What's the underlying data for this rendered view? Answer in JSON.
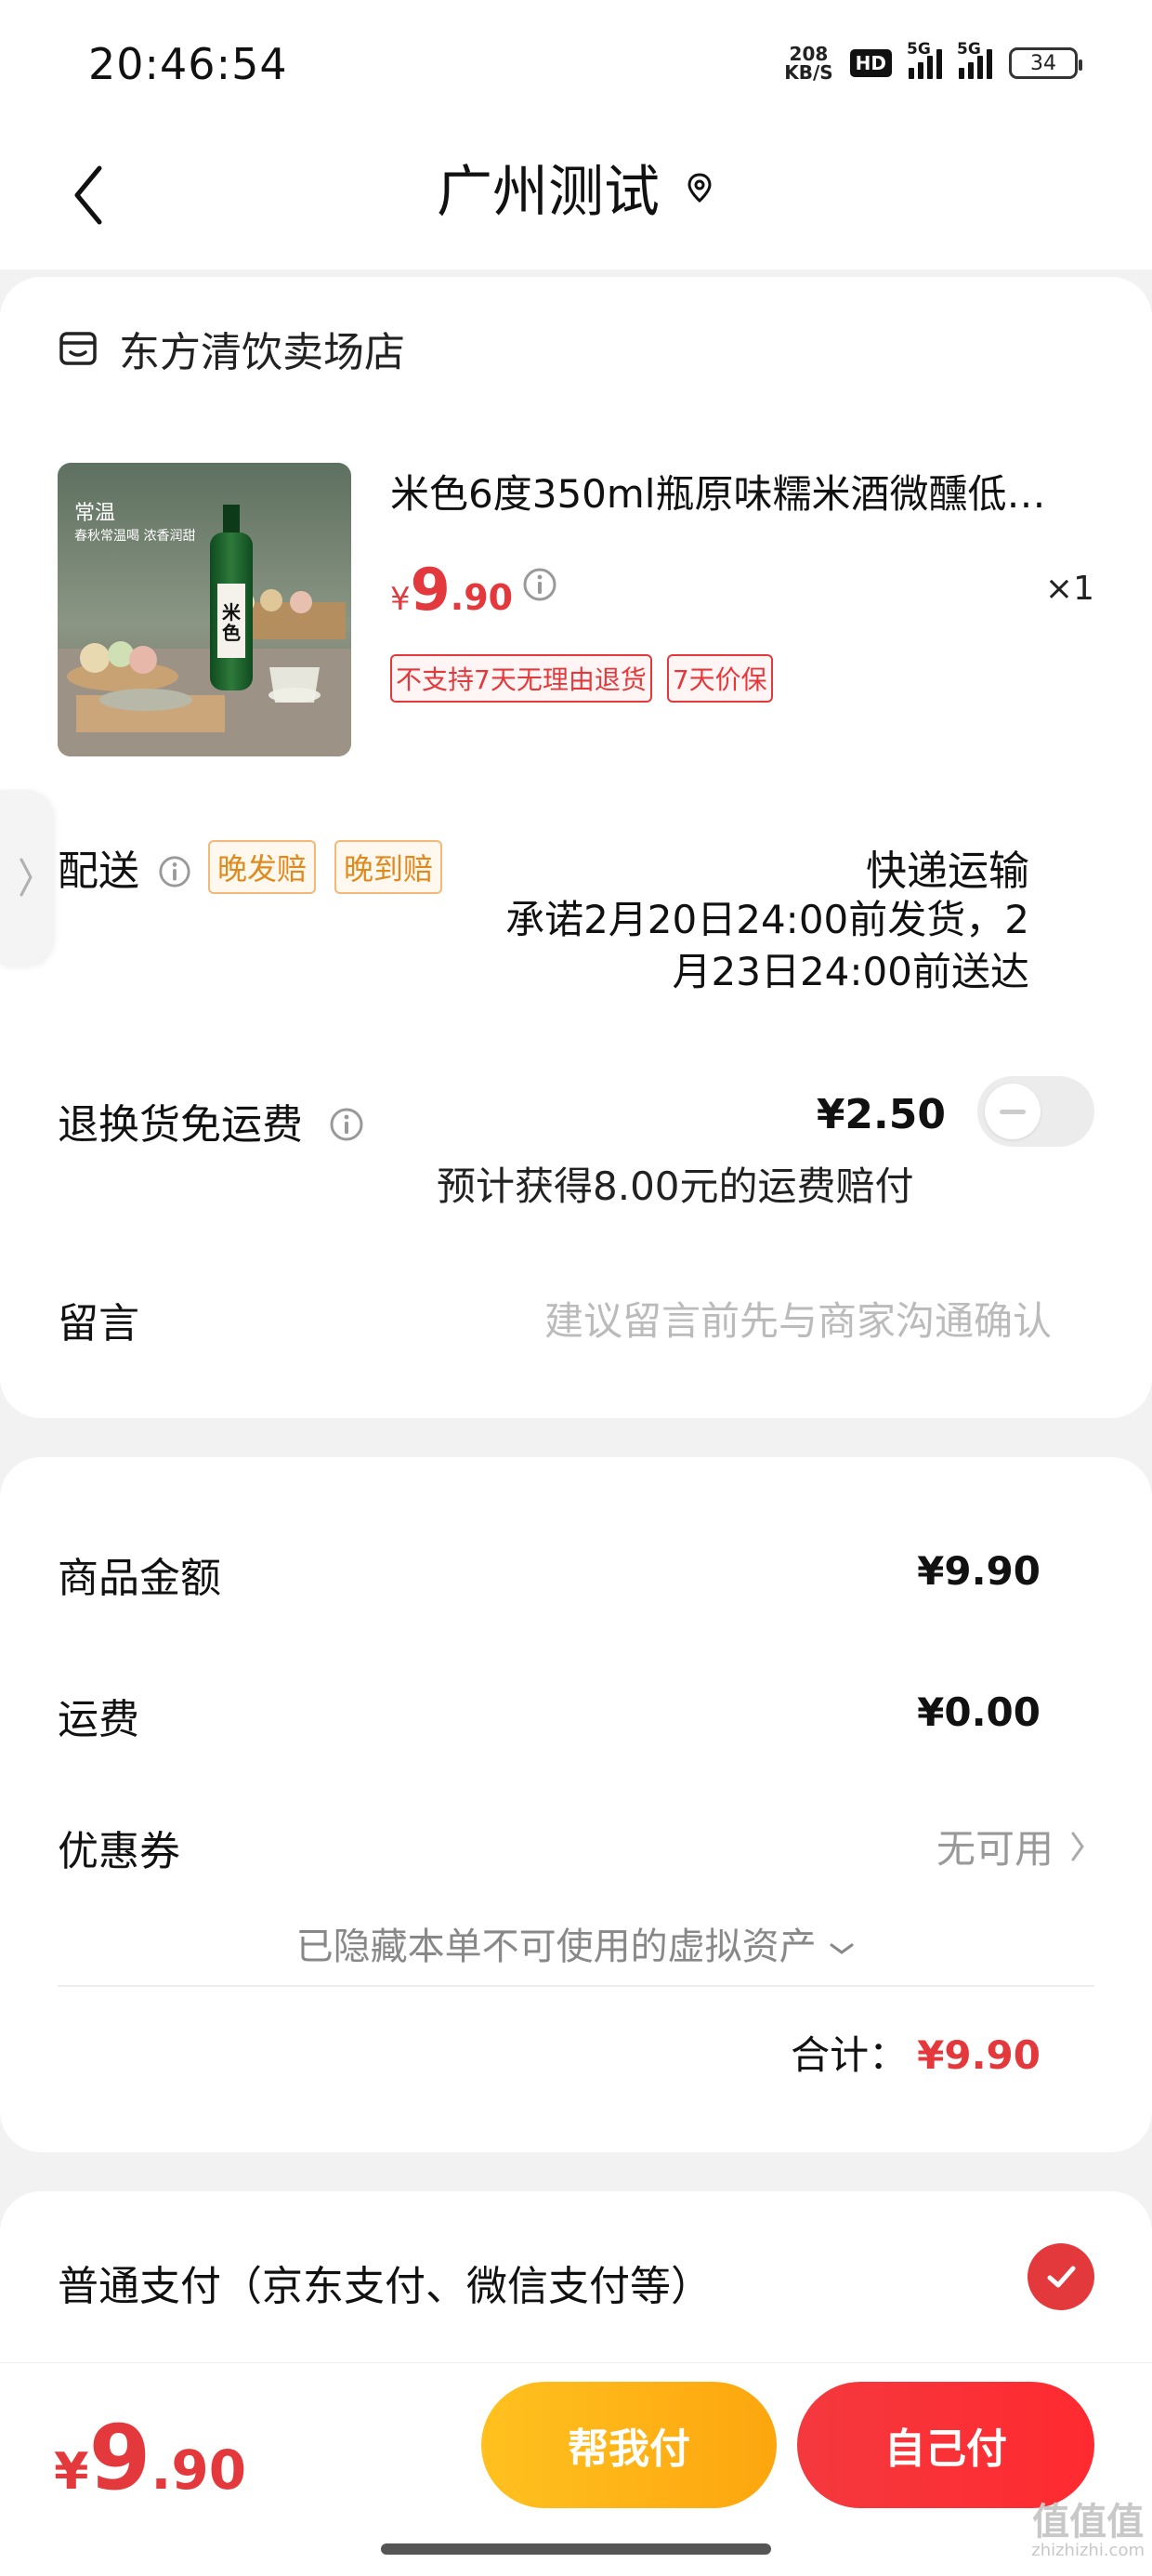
{
  "status_bar": {
    "time": "20:46:54",
    "net_speed_value": "208",
    "net_speed_unit": "KB/S",
    "hd_badge": "HD",
    "signal1_label": "5G",
    "signal2_label": "5G",
    "battery": "34"
  },
  "header": {
    "title": "广州测试"
  },
  "shop": {
    "name": "东方清饮卖场店"
  },
  "product": {
    "image_caption_title": "常温",
    "image_caption_sub": "春秋常温喝 浓香润甜",
    "bottle_label": "米色",
    "title": "米色6度350ml瓶原味糯米酒微醺低…",
    "price_symbol": "¥",
    "price_int": "9",
    "price_dec": ".90",
    "quantity": "×1",
    "tags": [
      "不支持7天无理由退货",
      "7天价保"
    ]
  },
  "delivery": {
    "label": "配送",
    "tags": [
      "晚发赔",
      "晚到赔"
    ],
    "method": "快递运输",
    "promise_line1": "承诺2月20日24:00前发货，2",
    "promise_line2": "月23日24:00前送达"
  },
  "return_shipping": {
    "label": "退换货免运费",
    "price": "¥2.50",
    "note": "预计获得8.00元的运费赔付"
  },
  "message": {
    "label": "留言",
    "placeholder": "建议留言前先与商家沟通确认"
  },
  "summary": {
    "goods_label": "商品金额",
    "goods_value": "¥9.90",
    "shipping_label": "运费",
    "shipping_value": "¥0.00",
    "coupon_label": "优惠券",
    "coupon_value": "无可用",
    "hidden_assets": "已隐藏本单不可使用的虚拟资产",
    "total_label": "合计：",
    "total_value": "¥9.90"
  },
  "payment": {
    "method_label": "普通支付（京东支付、微信支付等）"
  },
  "bottom_bar": {
    "price_symbol": "¥",
    "price_int": "9",
    "price_dec": ".90",
    "help_pay_label": "帮我付",
    "self_pay_label": "自己付"
  },
  "watermark": {
    "text": "值值值",
    "url": "zhizhizhi.com"
  },
  "colors": {
    "accent_red": "#e4393c",
    "accent_orange": "#fda60e",
    "tag_orange": "#e08a1e"
  }
}
